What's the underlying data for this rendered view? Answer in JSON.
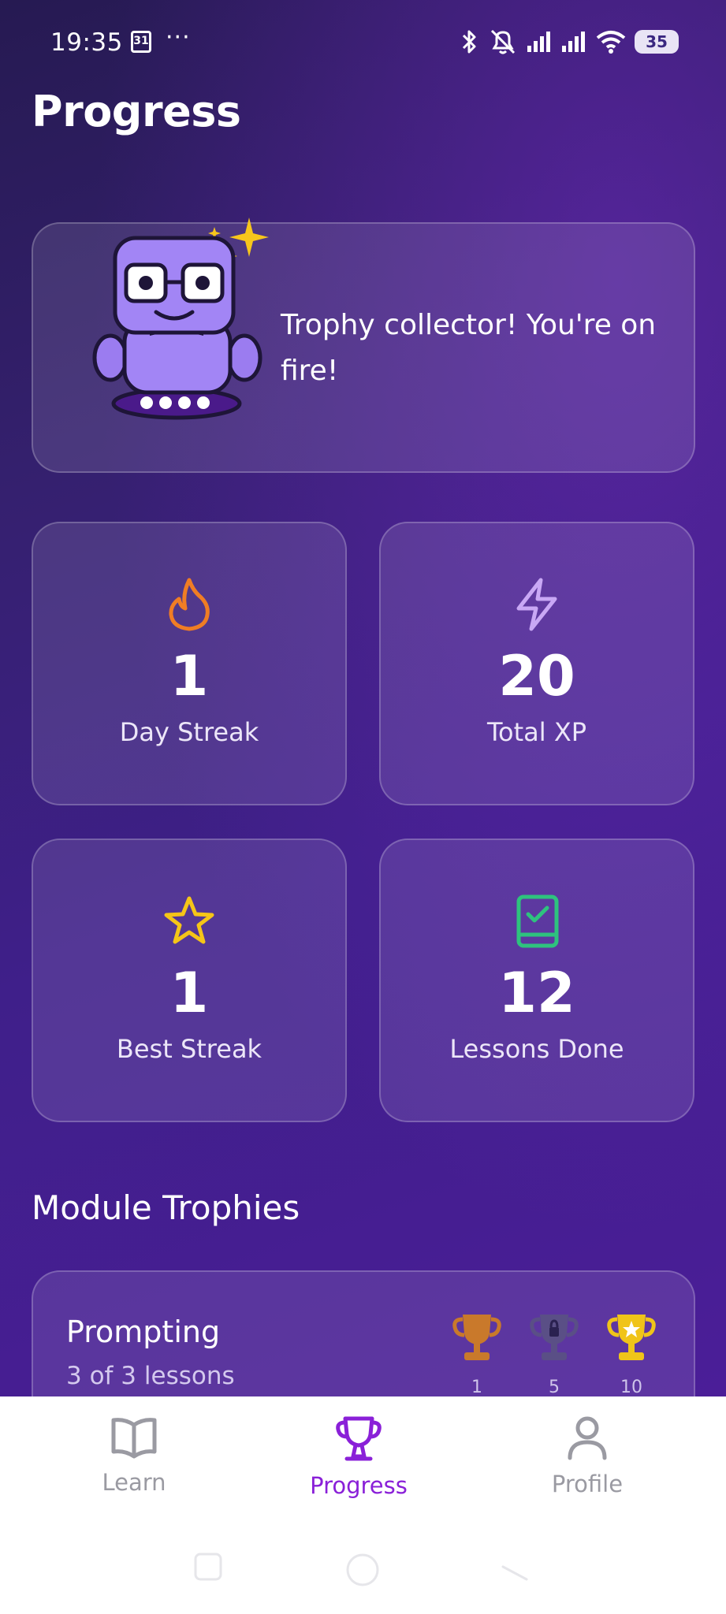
{
  "status_bar": {
    "time": "19:35",
    "calendar_day": "31",
    "more": "···",
    "battery": "35"
  },
  "page": {
    "title": "Progress"
  },
  "hero": {
    "message": "Trophy collector! You're on fire!"
  },
  "stats": [
    {
      "icon": "flame-icon",
      "value": "1",
      "label": "Day Streak",
      "color": "#f07d24"
    },
    {
      "icon": "lightning-icon",
      "value": "20",
      "label": "Total XP",
      "color": "#c9a8f5"
    },
    {
      "icon": "star-icon",
      "value": "1",
      "label": "Best Streak",
      "color": "#f5c518"
    },
    {
      "icon": "book-check-icon",
      "value": "12",
      "label": "Lessons Done",
      "color": "#2ec27e"
    }
  ],
  "module_trophies": {
    "title": "Module Trophies",
    "modules": [
      {
        "name": "Prompting",
        "progress": "3 of 3 lessons",
        "trophies": [
          {
            "level": "1",
            "tier": "bronze",
            "color": "#c9792b",
            "earned": true
          },
          {
            "level": "5",
            "tier": "silver",
            "color": "#5a4f86",
            "earned": false
          },
          {
            "level": "10",
            "tier": "gold",
            "color": "#f0c419",
            "earned": true
          }
        ]
      }
    ]
  },
  "bottom_nav": {
    "items": [
      {
        "label": "Learn",
        "icon": "book-icon",
        "active": false
      },
      {
        "label": "Progress",
        "icon": "trophy-icon",
        "active": true
      },
      {
        "label": "Profile",
        "icon": "person-icon",
        "active": false
      }
    ]
  },
  "colors": {
    "accent": "#8a20d8",
    "background_start": "#261a52",
    "background_end": "#4b1e98"
  }
}
